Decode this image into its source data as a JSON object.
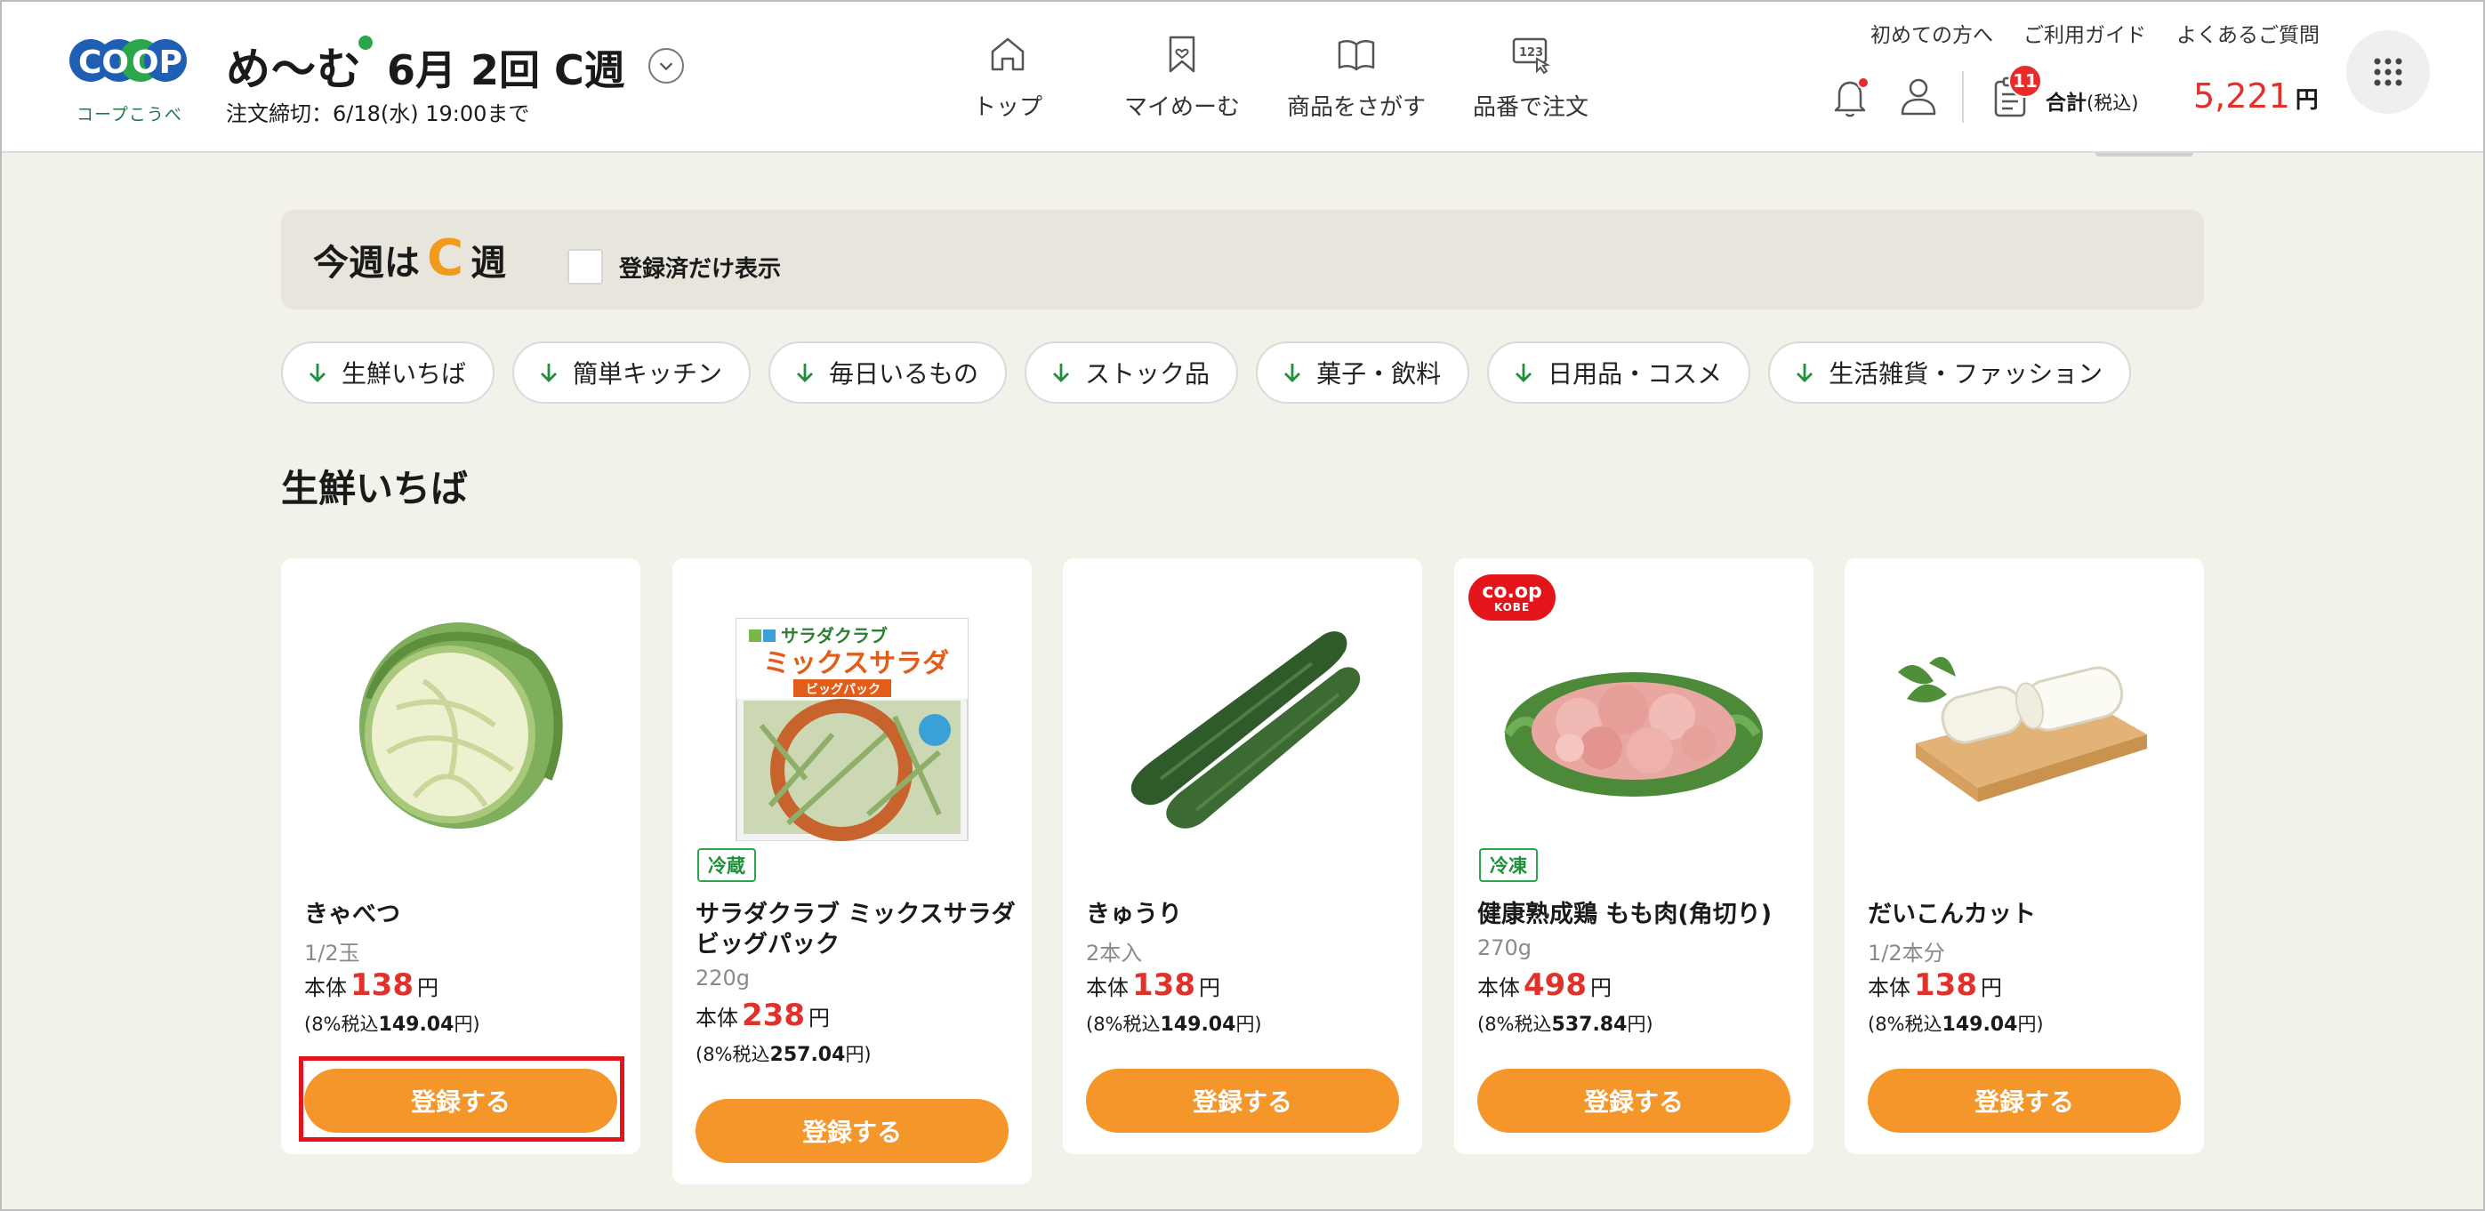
{
  "colors": {
    "accent": "#f5962a",
    "price": "#e0312b",
    "brand_green": "#2aa74a",
    "background": "#f2f1ea"
  },
  "header": {
    "logo_text": "CO-OP",
    "logo_sub": "コープこうべ",
    "service_name": "め〜む",
    "order_month": "6月",
    "order_round": "2回",
    "week": "C週",
    "deadline": "注文締切：6/18(水) 19:00まで",
    "nav": [
      {
        "label": "トップ",
        "icon": "home-icon"
      },
      {
        "label": "マイめーむ",
        "icon": "bookmark-heart-icon"
      },
      {
        "label": "商品をさがす",
        "icon": "book-icon"
      },
      {
        "label": "品番で注文",
        "icon": "number-entry-icon"
      }
    ],
    "links": [
      "初めての方へ",
      "ご利用ガイド",
      "よくあるご質問"
    ],
    "cart_count": "11",
    "total_label": "合計",
    "total_tax_note": "(税込)",
    "total_amount": "5,221",
    "total_unit": "円"
  },
  "week_bar": {
    "prefix": "今週は",
    "letter": "C",
    "suffix": "週",
    "filter_label": "登録済だけ表示",
    "filter_checked": false
  },
  "categories": [
    "生鮮いちば",
    "簡単キッチン",
    "毎日いるもの",
    "ストック品",
    "菓子・飲料",
    "日用品・コスメ",
    "生活雑貨・ファッション"
  ],
  "section_title": "生鮮いちば",
  "products": [
    {
      "name": "きゃべつ",
      "qty": "1/2玉",
      "price_label": "本体",
      "price": "138",
      "unit": "円",
      "tax_prefix": "(8%税込",
      "tax_int": "149",
      "tax_dec": ".04",
      "tax_suffix": "円)",
      "badge": "",
      "button": "登録する",
      "icon": "cabbage-image"
    },
    {
      "name": "サラダクラブ ミックスサラダ ビッグパック",
      "qty": "220g",
      "price_label": "本体",
      "price": "238",
      "unit": "円",
      "tax_prefix": "(8%税込",
      "tax_int": "257",
      "tax_dec": ".04",
      "tax_suffix": "円)",
      "badge": "冷蔵",
      "button": "登録する",
      "icon": "salad-pack-image",
      "pack_brand": "サラダクラブ",
      "pack_title": "ミックスサラダ",
      "pack_sub": "ビッグパック"
    },
    {
      "name": "きゅうり",
      "qty": "2本入",
      "price_label": "本体",
      "price": "138",
      "unit": "円",
      "tax_prefix": "(8%税込",
      "tax_int": "149",
      "tax_dec": ".04",
      "tax_suffix": "円)",
      "badge": "",
      "button": "登録する",
      "icon": "cucumber-image"
    },
    {
      "name": "健康熟成鶏 もも肉(角切り)",
      "qty": "270g",
      "price_label": "本体",
      "price": "498",
      "unit": "円",
      "tax_prefix": "(8%税込",
      "tax_int": "537",
      "tax_dec": ".84",
      "tax_suffix": "円)",
      "badge": "冷凍",
      "button": "登録する",
      "icon": "chicken-image",
      "brand_logo_top": "co.op",
      "brand_logo_bottom": "KOBE"
    },
    {
      "name": "だいこんカット",
      "qty": "1/2本分",
      "price_label": "本体",
      "price": "138",
      "unit": "円",
      "tax_prefix": "(8%税込",
      "tax_int": "149",
      "tax_dec": ".04",
      "tax_suffix": "円)",
      "badge": "",
      "button": "登録する",
      "icon": "daikon-image"
    }
  ]
}
